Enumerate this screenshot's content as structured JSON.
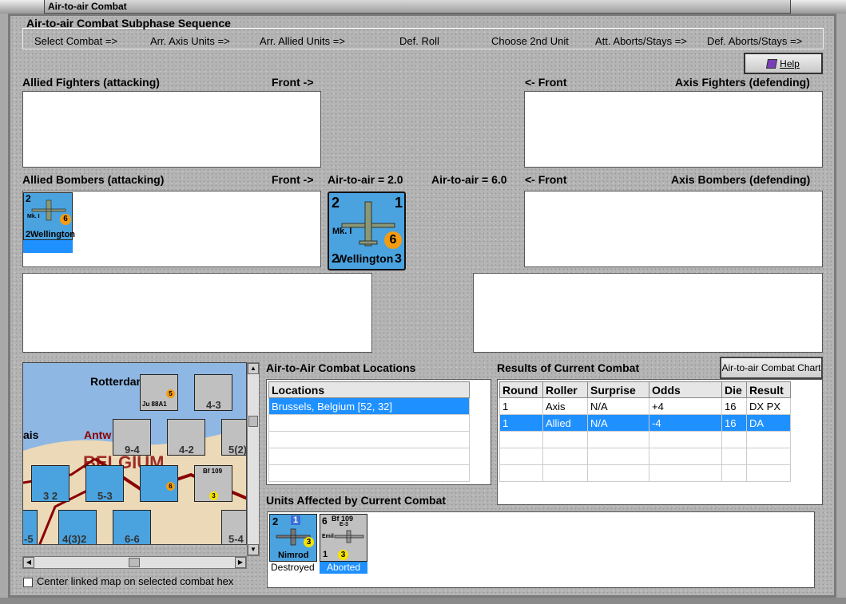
{
  "window": {
    "title": "Air-to-air Combat"
  },
  "sequence": {
    "title": "Air-to-air Combat Subphase Sequence",
    "steps": [
      "Select Combat =>",
      "Arr. Axis Units =>",
      "Arr. Allied Units =>",
      "Def. Roll",
      "Choose 2nd Unit",
      "Att. Aborts/Stays =>",
      "Def. Aborts/Stays =>"
    ]
  },
  "help": {
    "label": "Help",
    "icon": "book-icon"
  },
  "allied_fighters": {
    "label": "Allied Fighters (attacking)",
    "front": "Front ->"
  },
  "axis_fighters": {
    "label": "Axis Fighters (defending)",
    "front": "<- Front"
  },
  "allied_bombers": {
    "label": "Allied Bombers (attacking)",
    "front": "Front ->",
    "air_to_air": "Air-to-air = 2.0"
  },
  "axis_bombers": {
    "label": "Axis Bombers (defending)",
    "front": "<- Front",
    "air_to_air": "Air-to-air = 6.0"
  },
  "selected_unit": {
    "name": "Wellington",
    "model": "Mk. I",
    "top_left": "2",
    "top_right": "1",
    "bottom_left": "2",
    "bottom_right": "3",
    "badge": "6"
  },
  "small_unit": {
    "name": "Wellington",
    "model": "Mk. I",
    "top_left": "2",
    "bottom_left": "2",
    "badge": "6"
  },
  "map": {
    "labels": [
      "Rotterdam",
      "Antw",
      "ais",
      "BELGIUM"
    ],
    "counters": [
      "4-3",
      "9-4",
      "4-2",
      "5(2)",
      "3 2",
      "5-3",
      "6-6",
      "4(3)2",
      "5-4",
      "-5",
      "Bf 109",
      "Ju 88A1"
    ]
  },
  "center_linked": {
    "label": "Center linked map on selected combat hex",
    "checked": false
  },
  "locations": {
    "title": "Air-to-Air Combat Locations",
    "header": "Locations",
    "rows": [
      "Brussels, Belgium [52, 32]"
    ]
  },
  "results": {
    "title": "Results of Current Combat",
    "chart_button": "Air-to-air Combat Chart",
    "columns": [
      "Round",
      "Roller",
      "Surprise",
      "Odds",
      "Die",
      "Result"
    ],
    "rows": [
      [
        "1",
        "Axis",
        "N/A",
        "+4",
        "16",
        "DX PX"
      ],
      [
        "1",
        "Allied",
        "N/A",
        "-4",
        "16",
        "DA"
      ]
    ]
  },
  "affected": {
    "title": "Units Affected by Current Combat",
    "units": [
      {
        "name": "Nimrod",
        "top_left": "2",
        "top_mid": "1",
        "badge": "3",
        "status": "Destroyed"
      },
      {
        "name": "Emil",
        "model": "Bf 109",
        "sub": "E-3",
        "top_left": "6",
        "bottom_left": "1",
        "badge": "3",
        "status": "Aborted"
      }
    ]
  },
  "colors": {
    "unit_blue": "#4aa3df",
    "select_blue": "#1e90ff",
    "badge_orange": "#f39c12",
    "badge_yellow": "#f5e300"
  }
}
